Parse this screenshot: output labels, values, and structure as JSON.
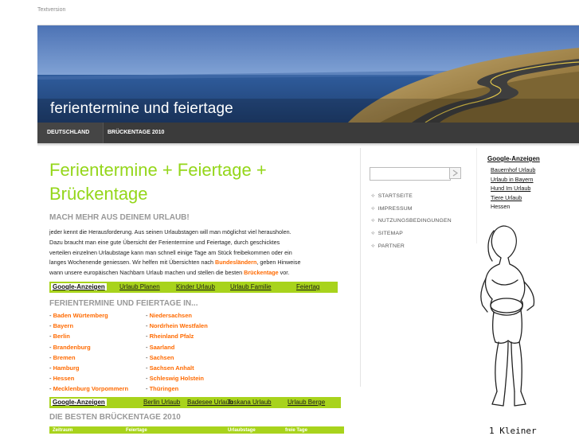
{
  "top": {
    "textversion": "Textversion"
  },
  "header": {
    "site_title": "ferientermine und feiertage"
  },
  "nav": {
    "items": [
      "DEUTSCHLAND",
      "BRÜCKENTAGE 2010"
    ]
  },
  "main": {
    "heading": "Ferientermine + Feiertage + Brückentage",
    "subheading": "MACH MEHR AUS DEINEM URLAUB!",
    "intro_lines": [
      "jeder kennt die Herausforderung. Aus seinen Urlaubstagen will man möglichst viel herausholen.",
      "Dazu braucht man eine gute Übersicht der Ferientermine und Feiertage, durch geschicktes",
      "verteilen einzelnen Urlaubstage kann man schnell einige Tage am Stück freibekommen oder ein",
      "langes Wochenende geniessen. Wir helfen mit Übersichten nach ",
      "wann unsere europäischen Nachbarn Urlaub machen und stellen die besten "
    ],
    "intro_highlight_1": "Bundesländern",
    "intro_after_1": ", geben Hinweise",
    "intro_highlight_2": "Brückentage",
    "intro_after_2": " vor.",
    "ads1": {
      "title": "Google-Anzeigen",
      "links": [
        "Urlaub Planen",
        "Kinder Urlaub",
        "Urlaub Familie",
        "Feiertag"
      ]
    },
    "states_heading": "FERIENTERMINE UND FEIERTAGE IN...",
    "states_left": [
      "Baden Würtemberg",
      "Bayern",
      "Berlin",
      "Brandenburg",
      "Bremen",
      "Hamburg",
      "Hessen",
      "Mecklenburg Vorpommern"
    ],
    "states_right": [
      "Niedersachsen",
      "Nordrhein Westfalen",
      "Rheinland Pfalz",
      "Saarland",
      "Sachsen",
      "Sachsen Anhalt",
      "Schleswig Holstein",
      "Thüringen"
    ],
    "ads2": {
      "title": "Google-Anzeigen",
      "links": [
        "Berlin Urlaub",
        "Badesee Urlaub",
        "Toskana Urlaub",
        "Urlaub Berge"
      ]
    },
    "bridge_heading": "DIE BESTEN BRÜCKENTAGE 2010",
    "table_headers": [
      "Zeitraum",
      "Feiertage",
      "Urlaubstage",
      "freie Tage"
    ]
  },
  "sidebar": {
    "search_placeholder": "",
    "menu": [
      "STARTSEITE",
      "IMPRESSUM",
      "NUTZUNGSBEDINGUNGEN",
      "SITEMAP",
      "PARTNER"
    ]
  },
  "right_ads": {
    "title": "Google-Anzeigen",
    "links": [
      "Bauernhof Urlaub",
      "Urlaub in Bayern",
      "Hund Im Urlaub",
      "Tiere Urlaub"
    ],
    "plain": "Hessen"
  },
  "cartoon": {
    "caption": "1 Kleiner"
  },
  "colors": {
    "accent": "#94d61a",
    "link_orange": "#ff6a00",
    "nav_bg": "#3b3b3b"
  }
}
